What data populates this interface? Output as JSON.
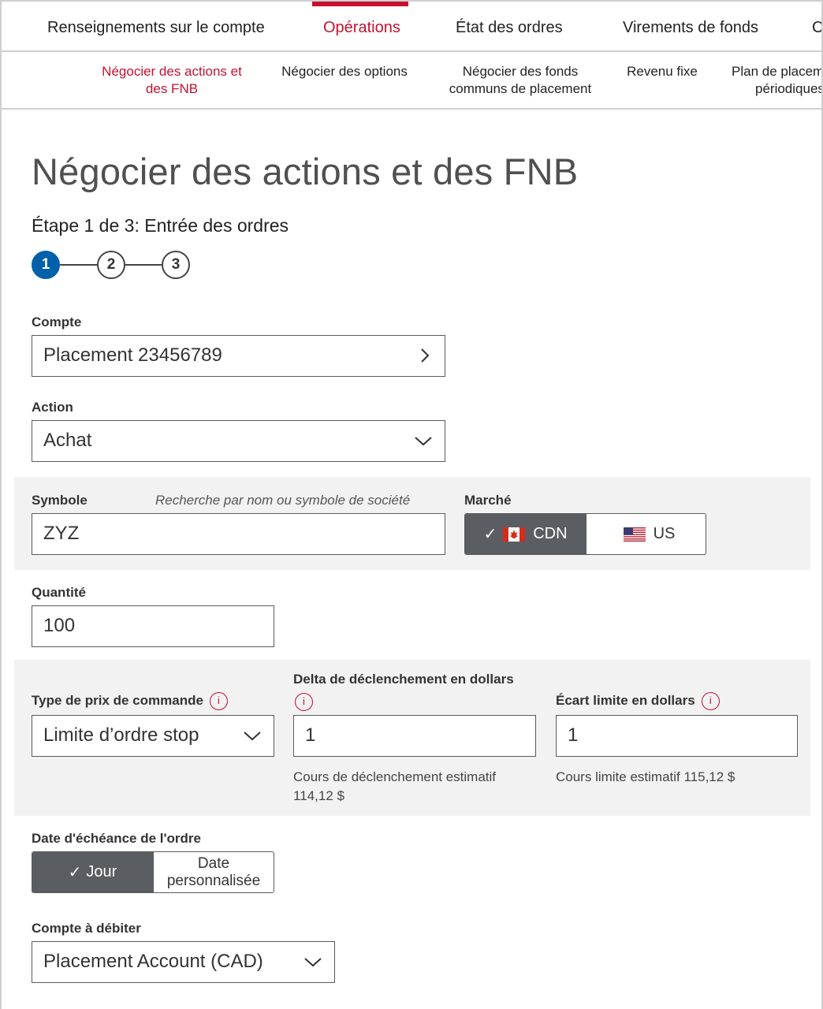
{
  "topnav": {
    "tabs": [
      {
        "label": "Renseignements sur le compte"
      },
      {
        "label": "Opérations"
      },
      {
        "label": "État des ordres"
      },
      {
        "label": "Virements de fonds"
      },
      {
        "label": "C"
      }
    ]
  },
  "subnav": {
    "items": [
      {
        "line1": "Négocier des actions et",
        "line2": "des FNB"
      },
      {
        "line1": "Négocier des options",
        "line2": ""
      },
      {
        "line1": "Négocier des fonds",
        "line2": "communs de placement"
      },
      {
        "line1": "Revenu fixe",
        "line2": ""
      },
      {
        "line1": "Plan de placem",
        "line2": "périodiques"
      }
    ]
  },
  "page": {
    "title": "Négocier des actions et des FNB",
    "step_label": "Étape 1 de 3: Entrée des ordres",
    "steps": [
      "1",
      "2",
      "3"
    ],
    "current_step": 1
  },
  "form": {
    "account": {
      "label": "Compte",
      "value": "Placement 23456789"
    },
    "action": {
      "label": "Action",
      "value": "Achat"
    },
    "symbol": {
      "label": "Symbole",
      "hint": "Recherche par nom ou symbole de société",
      "value": "ZYZ"
    },
    "market": {
      "label": "Marché",
      "options": [
        "CDN",
        "US"
      ],
      "selected": "CDN"
    },
    "quantity": {
      "label": "Quantité",
      "value": "100"
    },
    "price_type": {
      "label": "Type de prix de commande",
      "value": "Limite d’ordre stop"
    },
    "trigger_delta": {
      "label": "Delta de déclenchement en dollars",
      "value": "1",
      "note_line1": "Cours de déclenchement estimatif",
      "note_line2": "114,12 $"
    },
    "limit_offset": {
      "label": "Écart limite en dollars",
      "value": "1",
      "note": "Cours limite estimatif 115,12 $"
    },
    "expiry": {
      "label": "Date d'échéance de l'ordre",
      "options": [
        "Jour",
        "Date personnalisée"
      ],
      "custom_line1": "Date",
      "custom_line2": "personnalisée",
      "selected": "Jour"
    },
    "debit_account": {
      "label": "Compte à débiter",
      "value": "Placement Account (CAD)"
    },
    "info_glyph": "i",
    "check_glyph": "✓"
  },
  "colors": {
    "accent": "#c8102e",
    "step_active": "#0060a9",
    "selected_segment": "#5a5d62",
    "band": "#f2f2f2"
  }
}
